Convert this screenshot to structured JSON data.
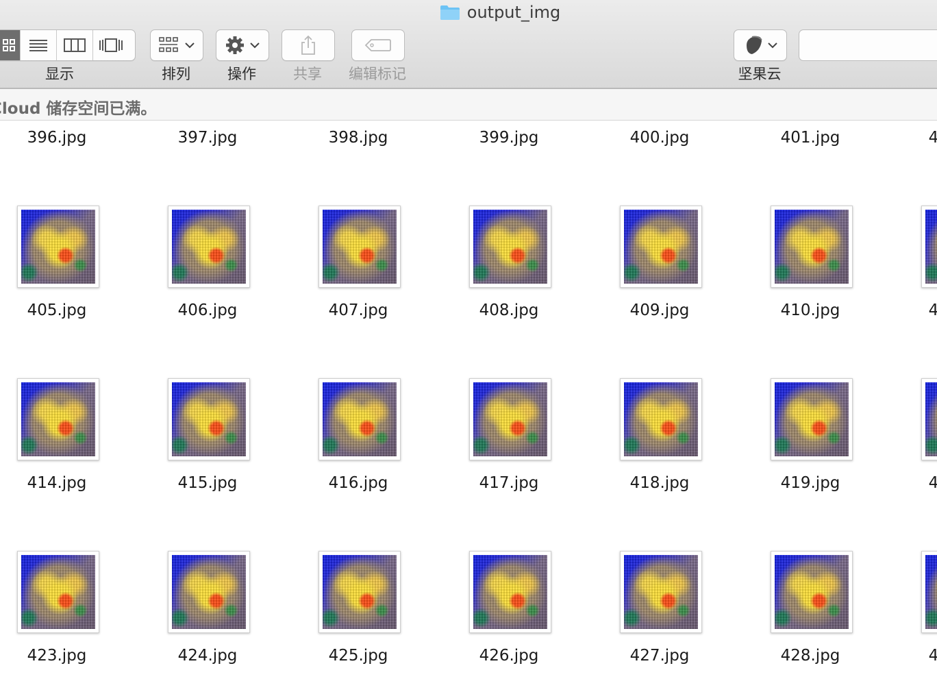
{
  "window": {
    "title": "output_img",
    "folder_color": "#6cc3f5"
  },
  "toolbar": {
    "view_label": "显示",
    "arrange_label": "排列",
    "action_label": "操作",
    "share_label": "共享",
    "tags_label": "编辑标记",
    "nutstore_label": "坚果云"
  },
  "banner": {
    "text": "Cloud 储存空间已满。"
  },
  "files": {
    "row0": [
      "396.jpg",
      "397.jpg",
      "398.jpg",
      "399.jpg",
      "400.jpg",
      "401.jpg",
      "4"
    ],
    "row1": [
      "405.jpg",
      "406.jpg",
      "407.jpg",
      "408.jpg",
      "409.jpg",
      "410.jpg",
      "4"
    ],
    "row2": [
      "414.jpg",
      "415.jpg",
      "416.jpg",
      "417.jpg",
      "418.jpg",
      "419.jpg",
      "4"
    ],
    "row3": [
      "423.jpg",
      "424.jpg",
      "425.jpg",
      "426.jpg",
      "427.jpg",
      "428.jpg",
      "4"
    ]
  }
}
